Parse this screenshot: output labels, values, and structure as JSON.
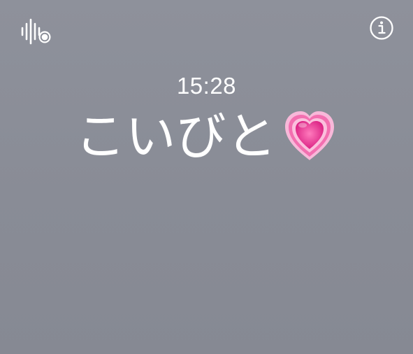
{
  "status": {
    "time": "15:28"
  },
  "main": {
    "title": "こいびと"
  },
  "icons": {
    "left": "sound-recognition-icon",
    "right": "info-icon",
    "title_emoji": "growing-heart-emoji"
  },
  "colors": {
    "background": "#8b8e98",
    "text": "#ffffff",
    "heart": "#ea4c9a"
  }
}
